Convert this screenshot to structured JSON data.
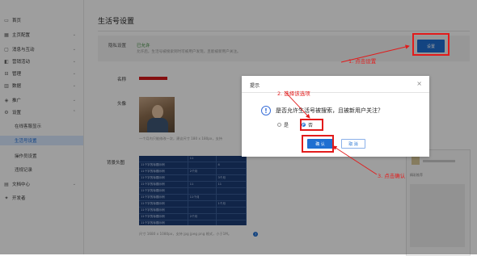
{
  "sidebar": {
    "items": [
      {
        "label": "首页",
        "icon": "monitor-icon",
        "has_arrow": false
      },
      {
        "label": "主页配置",
        "icon": "grid-icon",
        "has_arrow": true
      },
      {
        "label": "消息与互动",
        "icon": "chat-icon",
        "has_arrow": true
      },
      {
        "label": "营销活动",
        "icon": "gift-icon",
        "has_arrow": true
      },
      {
        "label": "管理",
        "icon": "manage-icon",
        "has_arrow": true
      },
      {
        "label": "数据",
        "icon": "chart-icon",
        "has_arrow": true
      },
      {
        "label": "推广",
        "icon": "promote-icon",
        "has_arrow": true
      },
      {
        "label": "设置",
        "icon": "gear-icon",
        "has_arrow": true
      }
    ],
    "sub_items": [
      {
        "label": "在线客服显示",
        "active": false
      },
      {
        "label": "生活号设置",
        "active": true
      },
      {
        "label": "操作员设置",
        "active": false
      },
      {
        "label": "违规记录",
        "active": false
      }
    ],
    "bottom_items": [
      {
        "label": "文档中心",
        "icon": "doc-icon",
        "has_arrow": true
      },
      {
        "label": "开发者",
        "icon": "dev-icon",
        "has_arrow": false
      }
    ]
  },
  "main": {
    "title": "生活号设置",
    "privacy": {
      "label": "隐私设置",
      "status": "已允许",
      "description": "允许后，生活号被搜索到时可被用户发现，且能被新用户关注。",
      "button": "设置"
    },
    "name_label": "名称",
    "avatar_label": "头像",
    "avatar_hint": "一个月内只能修改一次，建议尺寸 180 x 180px，支持",
    "background_label": "背景头图",
    "background_hint": "尺寸 1680 x 1080px，支持 jpg jpeg png 格式，小于1M。",
    "help_icon": "question-icon",
    "background_table": [
      [
        "",
        "11",
        ""
      ],
      [
        "11个字的标题示例",
        "",
        "4"
      ],
      [
        "11个字的标题示例",
        "2个月",
        ""
      ],
      [
        "11个字的标题示例",
        "",
        "3个月"
      ],
      [
        "11个字的标题示例",
        "11",
        "11"
      ],
      [
        "11个字的标题示例",
        "",
        ""
      ],
      [
        "11个字的标题示例",
        "11个月",
        ""
      ],
      [
        "11个字的标题示例",
        "",
        "1个月"
      ],
      [
        "11个字的标题示例",
        "",
        ""
      ],
      [
        "11个字的标题示例",
        "2个月",
        ""
      ],
      [
        "11个字的标题示例",
        "",
        ""
      ]
    ]
  },
  "preview": {
    "caption": "精彩推荐"
  },
  "dialog": {
    "title": "提示",
    "question": "是否允许生活号被搜索，且被新用户关注？",
    "options": [
      {
        "label": "是",
        "selected": false
      },
      {
        "label": "否",
        "selected": true
      }
    ],
    "ok_label": "确 认",
    "cancel_label": "取 消",
    "close_icon": "close-icon",
    "info_icon": "info-icon"
  },
  "annotations": {
    "step1": "1. 点击设置",
    "step2": "2. 选择该选项",
    "step3": "3. 点击确认",
    "color": "#e21b1b"
  },
  "colors": {
    "primary": "#1f6fd1",
    "active_bg": "#d9e8ff",
    "annotation_red": "#e21b1b"
  }
}
